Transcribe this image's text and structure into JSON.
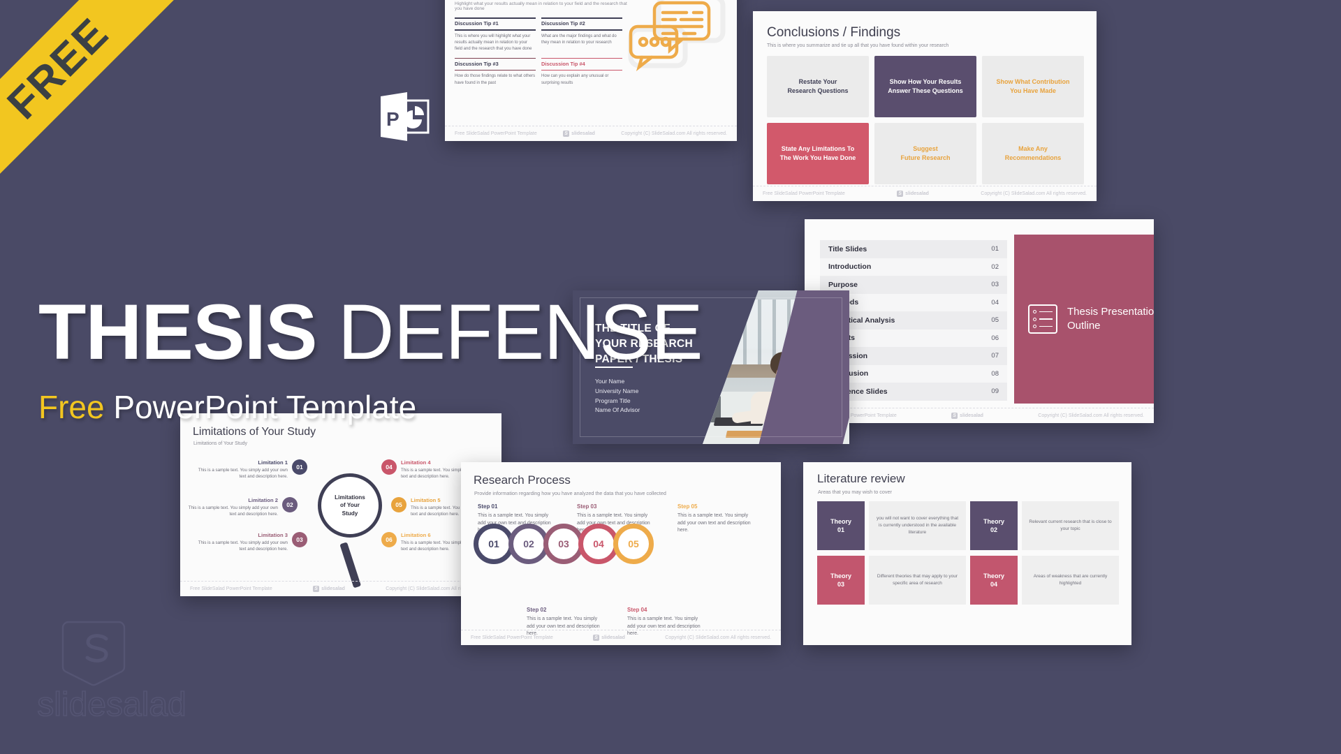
{
  "ribbon": {
    "label": "FREE"
  },
  "hero": {
    "title_bold": "THESIS",
    "title_light": " DEFENSE",
    "sub_gold": "Free",
    "sub_white": " PowerPoint Template"
  },
  "brand": {
    "name": "slidesalad",
    "mark": "S"
  },
  "footer_common": {
    "left": "Free SlideSalad PowerPoint Template",
    "center": "slidesalad",
    "right": "Copyright (C) SlideSalad.com All rights reserved."
  },
  "slide_discussion": {
    "lead": "Highlight what your results actually mean in relation to your field and the research that you have done",
    "tips": [
      {
        "title": "Discussion Tip #1",
        "body": "This is where you will highlight what your results actually mean in relation to your field and the research that you have done",
        "accent": "#3f3f55"
      },
      {
        "title": "Discussion Tip #2",
        "body": "What are the major findings and what do they mean in relation to your research",
        "accent": "#3f3f55"
      },
      {
        "title": "Discussion Tip #3",
        "body": "How do those findings relate to what others have found in the past",
        "accent": "#c9566a"
      },
      {
        "title": "Discussion Tip #4",
        "body": "How can you explain any unusual or surprising results",
        "accent": "#c9566a"
      }
    ]
  },
  "slide_conclusions": {
    "title": "Conclusions / Findings",
    "subtitle": "This is where you summarize and tie up all that you have found within your research",
    "boxes": [
      {
        "label": "Restate Your\nResearch Questions",
        "style": "grey"
      },
      {
        "label": "Show How Your Results\nAnswer These Questions",
        "style": "purple"
      },
      {
        "label": "Show What Contribution\nYou Have Made",
        "style": "gold"
      },
      {
        "label": "State Any Limitations To\nThe Work You Have Done",
        "style": "red"
      },
      {
        "label": "Suggest\nFuture Research",
        "style": "gold"
      },
      {
        "label": "Make Any\nRecommendations",
        "style": "gold"
      }
    ]
  },
  "slide_outline": {
    "panel_title": "Thesis Presentation\nOutline",
    "rows": [
      {
        "label": "Title Slides",
        "num": "01"
      },
      {
        "label": "Introduction",
        "num": "02"
      },
      {
        "label": "Purpose",
        "num": "03"
      },
      {
        "label": "Methods",
        "num": "04"
      },
      {
        "label": "Statistical Analysis",
        "num": "05"
      },
      {
        "label": "Results",
        "num": "06"
      },
      {
        "label": "Discussion",
        "num": "07"
      },
      {
        "label": "Conclusion",
        "num": "08"
      },
      {
        "label": "Reference Slides",
        "num": "09"
      }
    ]
  },
  "slide_title": {
    "line1": "THE TITLE OF",
    "line2": "YOUR RESEARCH",
    "line3_underlined": "PAPER",
    "line3_rest": " / THESIS",
    "meta": [
      "Your Name",
      "University Name",
      "Program Title",
      "Name Of Advisor"
    ]
  },
  "slide_limitations": {
    "title": "Limitations of Your Study",
    "subtitle": "Limitations of Your Study",
    "center_label": "Limitations\nof Your\nStudy",
    "items": [
      {
        "num": "01",
        "title": "Limitation 1",
        "body": "This is a sample text. You simply add your own text and description  here.",
        "color": "#4a4a6a",
        "side": "left"
      },
      {
        "num": "02",
        "title": "Limitation 2",
        "body": "This is a sample text. You simply add your own text and description  here.",
        "color": "#6b5c7e",
        "side": "left"
      },
      {
        "num": "03",
        "title": "Limitation 3",
        "body": "This is a sample text. You simply add your own text and description  here.",
        "color": "#9a5d75",
        "side": "left"
      },
      {
        "num": "04",
        "title": "Limitation 4",
        "body": "This is a sample text. You simply add your own text and description  here.",
        "color": "#c9566a",
        "side": "right"
      },
      {
        "num": "05",
        "title": "Limitation 5",
        "body": "This is a sample text. You simply add your own text and description  here.",
        "color": "#e8a33d",
        "side": "right"
      },
      {
        "num": "06",
        "title": "Limitation 6",
        "body": "This is a sample text. You simply add your own text and description  here.",
        "color": "#eeab4a",
        "side": "right"
      }
    ]
  },
  "slide_process": {
    "title": "Research Process",
    "subtitle": "Provide information regarding how you have analyzed the data that you have collected",
    "steps": [
      {
        "num": "01",
        "label": "Step 01",
        "body": "This is a sample text. You simply add your own text and description  here.",
        "color": "#4a4a6a"
      },
      {
        "num": "02",
        "label": "Step 02",
        "body": "This is a sample text. You simply add your own text and description  here.",
        "color": "#6b5c7e"
      },
      {
        "num": "03",
        "label": "Step 03",
        "body": "This is a sample text. You simply add your own text and description  here.",
        "color": "#9a5d75"
      },
      {
        "num": "04",
        "label": "Step 04",
        "body": "This is a sample text. You simply add your own text and description  here.",
        "color": "#c9566a"
      },
      {
        "num": "05",
        "label": "Step 05",
        "body": "This is a sample text. You simply add your own text and description  here.",
        "color": "#eeab4a"
      }
    ]
  },
  "slide_literature": {
    "title": "Literature review",
    "subtitle": "Areas that you may wish to cover",
    "cells": [
      {
        "tag": "Theory\n01",
        "style": "p",
        "desc": "you will not want to cover everything that is currently understood in the available literature"
      },
      {
        "tag": "Theory\n02",
        "style": "p",
        "desc": "Relevant current research that is close to your topic"
      },
      {
        "tag": "Theory\n03",
        "style": "r",
        "desc": "Different theories that may apply to your specific area of research"
      },
      {
        "tag": "Theory\n04",
        "style": "r",
        "desc": "Areas of weakness that are currently highlighted"
      }
    ]
  },
  "colors": {
    "background": "#4a4a66",
    "gold": "#f2c620",
    "purple": "#5a4e6e",
    "red": "#c9566a",
    "orange": "#e8a33d",
    "magenta": "#a8526c"
  }
}
